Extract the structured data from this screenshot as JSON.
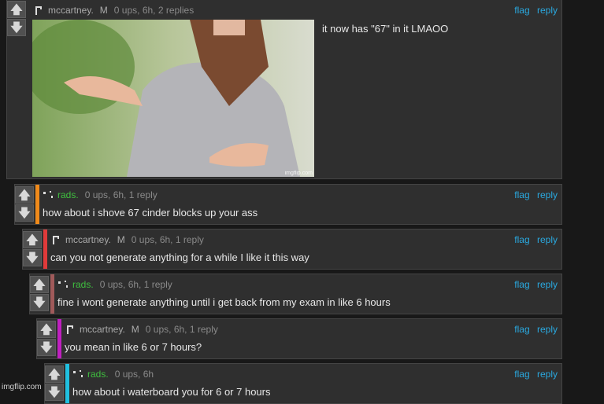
{
  "icons": {
    "upvote": "arrow-up",
    "downvote": "arrow-down",
    "avatar_mccartney": "hook-avatar",
    "avatar_rads": "dots-avatar"
  },
  "accent_colors": {
    "rads_name": "#3fbf3f",
    "links": "#2aa9e0",
    "bar_rads_1": "#f08a1a",
    "bar_mc_1": "#e03a3a",
    "bar_rads_2": "#a05a5a",
    "bar_mc_2": "#c020c0",
    "bar_rads_3": "#20c0e0"
  },
  "comments": [
    {
      "username": "mccartney.",
      "badge": "M",
      "meta": "0 ups, 6h, 2 replies",
      "flag": "flag",
      "reply": "reply",
      "text": "it now has \"67\" in it LMAOO",
      "image_watermark": "imgflip.com"
    },
    {
      "username": "rads.",
      "badge": "",
      "meta": "0 ups, 6h, 1 reply",
      "flag": "flag",
      "reply": "reply",
      "text": "how about i shove 67 cinder blocks up your ass"
    },
    {
      "username": "mccartney.",
      "badge": "M",
      "meta": "0 ups, 6h, 1 reply",
      "flag": "flag",
      "reply": "reply",
      "text": "can you not generate anything for a while I like it this way"
    },
    {
      "username": "rads.",
      "badge": "",
      "meta": "0 ups, 6h, 1 reply",
      "flag": "flag",
      "reply": "reply",
      "text": "fine i wont generate anything until i get back from my exam in like 6 hours"
    },
    {
      "username": "mccartney.",
      "badge": "M",
      "meta": "0 ups, 6h, 1 reply",
      "flag": "flag",
      "reply": "reply",
      "text": "you mean in like 6 or 7 hours?"
    },
    {
      "username": "rads.",
      "badge": "",
      "meta": "0 ups, 6h",
      "flag": "flag",
      "reply": "reply",
      "text": "how about i waterboard you for 6 or 7 hours"
    }
  ],
  "footer_watermark": "imgflip.com"
}
